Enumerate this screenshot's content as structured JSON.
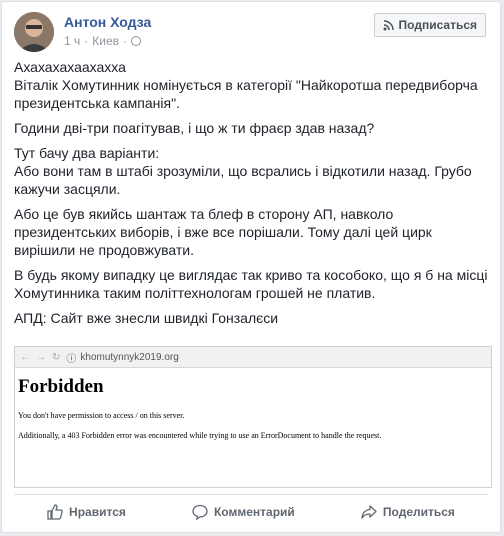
{
  "post": {
    "author": "Антон Ходза",
    "time": "1 ч",
    "separator": "·",
    "location": "Киев",
    "subscribe_label": "Подписаться",
    "paragraphs": [
      "Ахахахахаахахха\nВіталік Хомутинник номінується в категорії \"Найкоротша передвиборча президентська кампанія\".",
      "Години дві-три поагітував, і що ж ти фраєр здав назад?",
      "Тут бачу два варіанти:\nАбо вони там в штабі зрозуміли, що всрались і відкотили назад. Грубо кажучи засцяли.",
      "Або це був якийсь шантаж та блеф в сторону АП, навколо президентських виборів, і вже все порішали. Тому далі цей цирк вирішили не продовжувати.",
      "В будь якому випадку це виглядає так криво та кособоко, що я б на місці Хомутинника таким політтехнологам грошей не платив.",
      "АПД: Сайт вже знесли швидкі Гонзалєси"
    ]
  },
  "screenshot": {
    "url": "khomutynnyk2019.org",
    "title": "Forbidden",
    "line1": "You don't have permission to access / on this server.",
    "line2": "Additionally, a 403 Forbidden error was encountered while trying to use an ErrorDocument to handle the request."
  },
  "actions": {
    "like": "Нравится",
    "comment": "Комментарий",
    "share": "Поделиться"
  },
  "icons": {
    "rss": "rss-icon",
    "globe": "globe-icon",
    "like": "thumbs-up-icon",
    "comment": "speech-bubble-icon",
    "share": "share-arrow-icon"
  },
  "colors": {
    "author": "#365899",
    "meta": "#90949c",
    "text": "#1d2129"
  }
}
